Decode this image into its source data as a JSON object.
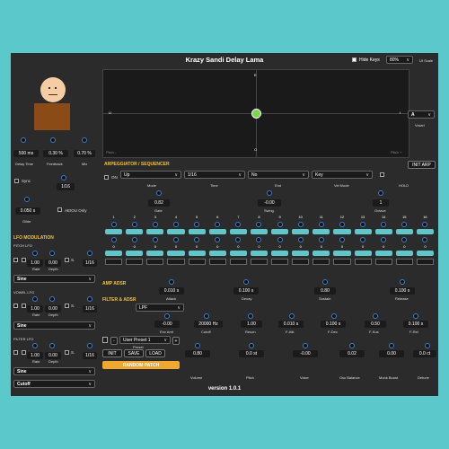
{
  "app": {
    "title": "Krazy Sandi Delay Lama",
    "hide_keys_label": "Hide Keys",
    "ui_scale_value": "80%",
    "ui_scale_label": "UI Scale",
    "version": "version 1.0.1"
  },
  "xy_pad": {
    "top": "E",
    "bottom": "O",
    "left": "U",
    "right": "I",
    "pitch_left": "Pitch -",
    "pitch_right": "Pitch +"
  },
  "vowel": {
    "value": "A",
    "label": "Vowel"
  },
  "delay": {
    "time_value": "500 ms",
    "time_label": "Delay Time",
    "feedback_value": "0.30 %",
    "feedback_label": "Feedback",
    "mix_value": "0.70 %",
    "mix_label": "Mix"
  },
  "sync": {
    "label": "Sync",
    "value": "0.050 s",
    "label2": "Glide",
    "division": "1/16",
    "aeiou_label": "AEIOU Only"
  },
  "lfo": {
    "title": "LFO MODULATION",
    "pitch": {
      "label": "PITCH LFO",
      "rate": "1.00",
      "depth": "0.00",
      "s_label": "S.",
      "division": "1/16",
      "rate_label": "Rate",
      "depth_label": "Depth",
      "wave": "Sine"
    },
    "vowel": {
      "label": "VOWEL LFO",
      "rate": "1.00",
      "depth": "0.00",
      "s_label": "S.",
      "division": "1/16",
      "rate_label": "Rate",
      "depth_label": "Depth",
      "wave": "Sine"
    },
    "filter": {
      "label": "FILTER LFO",
      "rate": "1.00",
      "depth": "0.00",
      "s_label": "S.",
      "division": "1/16",
      "rate_label": "Rate",
      "depth_label": "Depth",
      "wave": "Sine",
      "target": "Cutoff"
    }
  },
  "arp": {
    "title": "ARPEGGIATOR / SEQUENCER",
    "init_label": "INIT ARP",
    "on_label": "ON",
    "mode": "Up",
    "time": "1/16",
    "end": "No",
    "vel_mode": "Key",
    "mode_label": "Mode",
    "time_label": "Time",
    "end_label": "End",
    "vel_label": "Vel Mode",
    "hold_label": "HOLD",
    "gate_value": "0.82",
    "gate_label": "Gate",
    "swing_value": "-0.00",
    "swing_label": "Swing",
    "octave_value": "1",
    "octave_label": "Octave",
    "steps": [
      "1",
      "2",
      "3",
      "4",
      "5",
      "6",
      "7",
      "8",
      "9",
      "10",
      "11",
      "12",
      "13",
      "14",
      "15",
      "16"
    ],
    "step_values": [
      "0",
      "0",
      "0",
      "0",
      "0",
      "0",
      "0",
      "0",
      "0",
      "0",
      "0",
      "0",
      "0",
      "0",
      "0",
      "0"
    ]
  },
  "amp": {
    "title": "AMP ADSR",
    "attack": "0.010 s",
    "decay": "0.100 s",
    "sustain": "0.80",
    "release": "0.100 s",
    "attack_label": "Attack",
    "decay_label": "Decay",
    "sustain_label": "Sustain",
    "release_label": "Release"
  },
  "filter": {
    "title": "FILTER & ADSR",
    "type": "LPF",
    "env_amt": "-0.00",
    "cutoff": "20000 Hz",
    "reson": "1.00",
    "fatk": "0.010 s",
    "fdec": "0.100 s",
    "fsus": "0.50",
    "frel": "0.100 s",
    "env_amt_label": "Env Amt",
    "cutoff_label": "Cutoff",
    "reson_label": "Reson",
    "fatk_label": "F-Atk",
    "fdec_label": "F-Dec",
    "fsus_label": "F-Sus",
    "frel_label": "F-Rel"
  },
  "preset": {
    "minus": "-",
    "plus": "+",
    "name": "User Preset 1",
    "label": "Preset",
    "init": "INIT",
    "save": "SAVE",
    "load": "LOAD",
    "random": "RANDOM PATCH"
  },
  "master": {
    "volume": "0.80",
    "pitch": "0.0 st",
    "voice": "-0.00",
    "osc_balance": "0.02",
    "monk_boost": "0.00",
    "detune": "0.0 ct",
    "volume_label": "Volume",
    "pitch_label": "Pitch",
    "voice_label": "Voice",
    "osc_label": "Osc Balance",
    "monk_label": "Monk Boost",
    "detune_label": "Detune"
  },
  "colors": {
    "accent": "#f0c23a",
    "teal": "#5fc7c9",
    "knob": "#3a7fd6",
    "random_button": "#f0a830",
    "background": "#2b2b2b"
  }
}
